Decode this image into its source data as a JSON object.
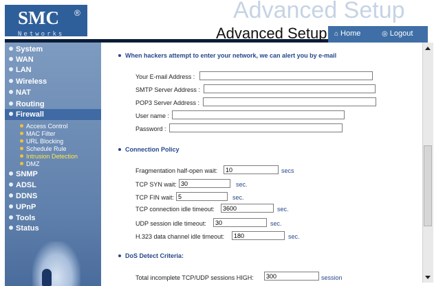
{
  "header": {
    "logo_text": "SMC",
    "logo_reg": "®",
    "logo_sub": "Networks",
    "watermark": "Advanced Setup",
    "title": "Advanced Setup",
    "home_label": "Home",
    "logout_label": "Logout"
  },
  "sidebar": {
    "items": [
      {
        "label": "System"
      },
      {
        "label": "WAN"
      },
      {
        "label": "LAN"
      },
      {
        "label": "Wireless"
      },
      {
        "label": "NAT"
      },
      {
        "label": "Routing"
      },
      {
        "label": "Firewall"
      },
      {
        "label": "SNMP"
      },
      {
        "label": "ADSL"
      },
      {
        "label": "DDNS"
      },
      {
        "label": "UPnP"
      },
      {
        "label": "Tools"
      },
      {
        "label": "Status"
      }
    ],
    "firewall_sub": [
      {
        "label": "Access Control"
      },
      {
        "label": "MAC Filter"
      },
      {
        "label": "URL Blocking"
      },
      {
        "label": "Schedule Rule"
      },
      {
        "label": "Intrusion Detection"
      },
      {
        "label": "DMZ"
      }
    ],
    "active_item": "Firewall",
    "active_sub": "Intrusion Detection"
  },
  "content": {
    "email_section": "When hackers attempt to enter your network, we can alert you by e-mail",
    "email_fields": {
      "email_label": "Your E-mail Address :",
      "email_value": "",
      "smtp_label": "SMTP Server Address :",
      "smtp_value": "",
      "pop3_label": "POP3 Server Address :",
      "pop3_value": "",
      "username_label": "User name :",
      "username_value": "",
      "password_label": "Password :",
      "password_value": ""
    },
    "policy_section": "Connection Policy",
    "policy": {
      "frag_label": "Fragmentation half-open wait:",
      "frag_value": "10",
      "frag_unit": "secs",
      "syn_label": "TCP SYN wait:",
      "syn_value": "30",
      "syn_unit": "sec.",
      "fin_label": "TCP FIN wait:",
      "fin_value": "5",
      "fin_unit": "sec.",
      "idle_label": "TCP connection idle timeout:",
      "idle_value": "3600",
      "idle_unit": "sec.",
      "udp_label": "UDP session idle timeout:",
      "udp_value": "30",
      "udp_unit": "sec.",
      "h323_label": "H.323 data channel idle timeout:",
      "h323_value": "180",
      "h323_unit": "sec."
    },
    "dos_section": "DoS Detect Criteria:",
    "dos": {
      "high_label": "Total incomplete TCP/UDP sessions HIGH:",
      "high_value": "300",
      "high_unit": "session"
    }
  },
  "colors": {
    "accent": "#26478a",
    "sidebar": "#5f80ac",
    "active_sub": "#ffe84a"
  }
}
